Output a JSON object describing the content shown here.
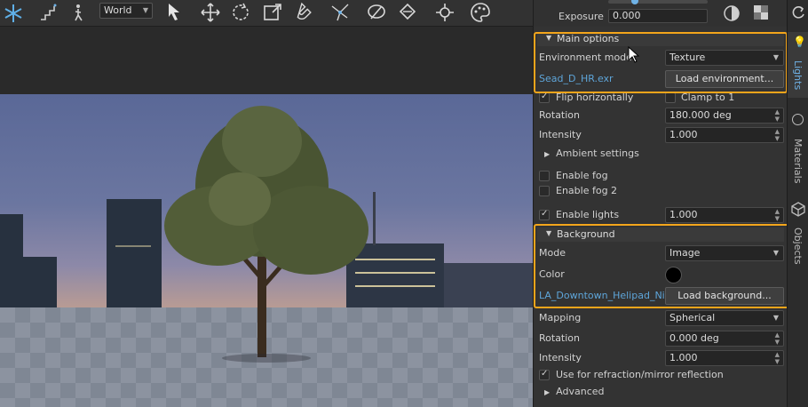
{
  "toolbar": {
    "space_select": "World",
    "icons": [
      "snowflake-icon",
      "stairs-icon",
      "walk-icon",
      "cursor-icon",
      "move-icon",
      "rotate-icon",
      "scale-icon",
      "magnet-icon",
      "network-icon",
      "paint-icon",
      "paint-bucket-icon",
      "crosshair-icon",
      "palette-icon"
    ]
  },
  "top": {
    "exposure_label": "Exposure",
    "exposure_value": "0.000"
  },
  "main_options": {
    "title": "Main options",
    "environment_mode_label": "Environment mode",
    "environment_mode_value": "Texture",
    "env_file": "Sead_D_HR.exr",
    "load_env_button": "Load environment...",
    "flip_horizontally": "Flip horizontally",
    "clamp_to_1": "Clamp to 1",
    "rotation_label": "Rotation",
    "rotation_value": "180.000 deg",
    "intensity_label": "Intensity",
    "intensity_value": "1.000",
    "ambient_settings": "Ambient settings",
    "enable_fog": "Enable fog",
    "enable_fog_2": "Enable fog 2",
    "enable_lights": "Enable lights",
    "enable_lights_value": "1.000"
  },
  "background": {
    "title": "Background",
    "mode_label": "Mode",
    "mode_value": "Image",
    "color_label": "Color",
    "bg_file": "LA_Downtown_Helipad_Nigh",
    "load_bg_button": "Load background...",
    "mapping_label": "Mapping",
    "mapping_value": "Spherical",
    "rotation_label": "Rotation",
    "rotation_value": "0.000 deg",
    "intensity_label": "Intensity",
    "intensity_value": "1.000",
    "use_for_refraction": "Use for refraction/mirror reflection",
    "advanced": "Advanced"
  },
  "side_tabs": {
    "lights": "Lights",
    "materials": "Materials",
    "objects": "Objects"
  },
  "colors": {
    "highlight": "#f3a51b",
    "link": "#5ea5d9",
    "active_tab": "#6fb2e6"
  }
}
